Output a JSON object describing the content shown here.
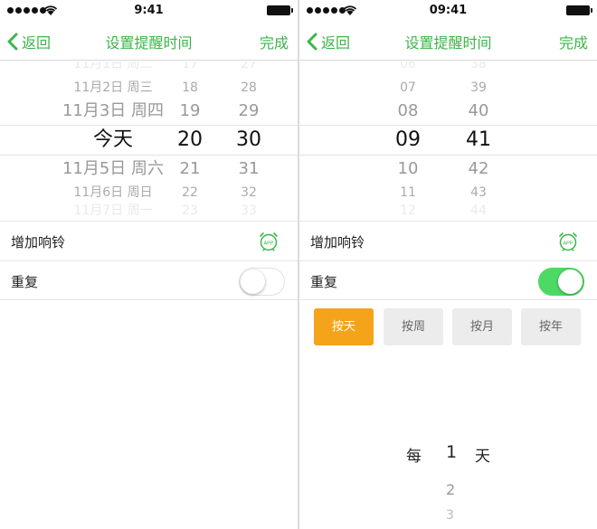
{
  "colors": {
    "accent_green": "#3cb54a",
    "switch_on": "#4cd964",
    "selected_button": "#f5a31a"
  },
  "left": {
    "status": {
      "time": "9:41"
    },
    "nav": {
      "back": "返回",
      "title": "设置提醒时间",
      "done": "完成"
    },
    "picker": {
      "rows": [
        {
          "date": "11月2日 周三",
          "hour": "18",
          "minute": "28"
        },
        {
          "date": "11月3日 周四",
          "hour": "19",
          "minute": "29"
        },
        {
          "date": "今天",
          "hour": "20",
          "minute": "30"
        },
        {
          "date": "11月5日 周六",
          "hour": "21",
          "minute": "31"
        },
        {
          "date": "11月6日 周日",
          "hour": "22",
          "minute": "32"
        }
      ]
    },
    "add_ringtone": {
      "label": "增加响铃",
      "icon": "alarm-clock-app-icon",
      "badge": "APP"
    },
    "repeat": {
      "label": "重复",
      "on": false
    }
  },
  "right": {
    "status": {
      "time": "09:41"
    },
    "nav": {
      "back": "返回",
      "title": "设置提醒时间",
      "done": "完成"
    },
    "picker": {
      "rows": [
        {
          "hour": "07",
          "minute": "39"
        },
        {
          "hour": "08",
          "minute": "40"
        },
        {
          "hour": "09",
          "minute": "41"
        },
        {
          "hour": "10",
          "minute": "42"
        },
        {
          "hour": "11",
          "minute": "43"
        }
      ]
    },
    "add_ringtone": {
      "label": "增加响铃",
      "icon": "alarm-clock-app-icon",
      "badge": "APP"
    },
    "repeat": {
      "label": "重复",
      "on": true
    },
    "repeat_options": [
      {
        "label": "按天",
        "selected": true
      },
      {
        "label": "按周",
        "selected": false
      },
      {
        "label": "按月",
        "selected": false
      },
      {
        "label": "按年",
        "selected": false
      }
    ],
    "interval": {
      "prefix": "每",
      "unit": "天",
      "values": [
        "1",
        "2",
        "3"
      ]
    }
  }
}
